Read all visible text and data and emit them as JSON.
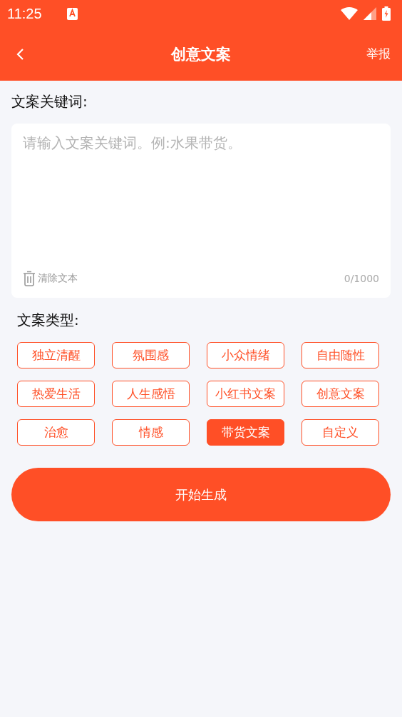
{
  "status_bar": {
    "time": "11:25"
  },
  "nav": {
    "title": "创意文案",
    "action": "举报"
  },
  "keywords": {
    "label": "文案关键词:",
    "placeholder": "请输入文案关键词。例:水果带货。",
    "clear": "清除文本",
    "counter": "0/1000"
  },
  "types": {
    "label": "文案类型:",
    "chips": [
      {
        "label": "独立清醒",
        "selected": false
      },
      {
        "label": "氛围感",
        "selected": false
      },
      {
        "label": "小众情绪",
        "selected": false
      },
      {
        "label": "自由随性",
        "selected": false
      },
      {
        "label": "热爱生活",
        "selected": false
      },
      {
        "label": "人生感悟",
        "selected": false
      },
      {
        "label": "小红书文案",
        "selected": false
      },
      {
        "label": "创意文案",
        "selected": false
      },
      {
        "label": "治愈",
        "selected": false
      },
      {
        "label": "情感",
        "selected": false
      },
      {
        "label": "带货文案",
        "selected": true
      },
      {
        "label": "自定义",
        "selected": false
      }
    ]
  },
  "generate_button": "开始生成"
}
